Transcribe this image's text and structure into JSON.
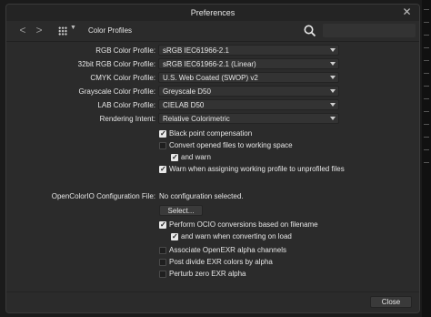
{
  "window": {
    "title": "Preferences"
  },
  "toolbar": {
    "back_label": "<",
    "forward_label": ">",
    "breadcrumb": "Color Profiles"
  },
  "profiles": [
    {
      "label": "RGB Color Profile:",
      "value": "sRGB IEC61966-2.1"
    },
    {
      "label": "32bit RGB Color Profile:",
      "value": "sRGB IEC61966-2.1 (Linear)"
    },
    {
      "label": "CMYK Color Profile:",
      "value": "U.S. Web Coated (SWOP) v2"
    },
    {
      "label": "Grayscale Color Profile:",
      "value": "Greyscale D50"
    },
    {
      "label": "LAB Color Profile:",
      "value": "CIELAB D50"
    },
    {
      "label": "Rendering Intent:",
      "value": "Relative Colorimetric"
    }
  ],
  "options": [
    {
      "label": "Black point compensation",
      "checked": true,
      "indent": 0
    },
    {
      "label": "Convert opened files to working space",
      "checked": false,
      "indent": 0
    },
    {
      "label": "and warn",
      "checked": true,
      "indent": 1
    },
    {
      "label": "Warn when assigning working profile to unprofiled files",
      "checked": true,
      "indent": 0
    }
  ],
  "ocio": {
    "config_label": "OpenColorIO Configuration File:",
    "config_value": "No configuration selected.",
    "select_button": "Select...",
    "options": [
      {
        "label": "Perform OCIO conversions based on filename",
        "checked": true,
        "indent": 0
      },
      {
        "label": "and warn when converting on load",
        "checked": true,
        "indent": 1
      }
    ]
  },
  "exr": [
    {
      "label": "Associate OpenEXR alpha channels",
      "checked": false
    },
    {
      "label": "Post divide EXR colors by alpha",
      "checked": false
    },
    {
      "label": "Perturb zero EXR alpha",
      "checked": false
    }
  ],
  "footer": {
    "close_button": "Close"
  },
  "icons": {
    "close": "close-icon",
    "back": "chevron-left-icon",
    "forward": "chevron-right-icon",
    "grid": "grid-icon",
    "search": "search-icon"
  }
}
